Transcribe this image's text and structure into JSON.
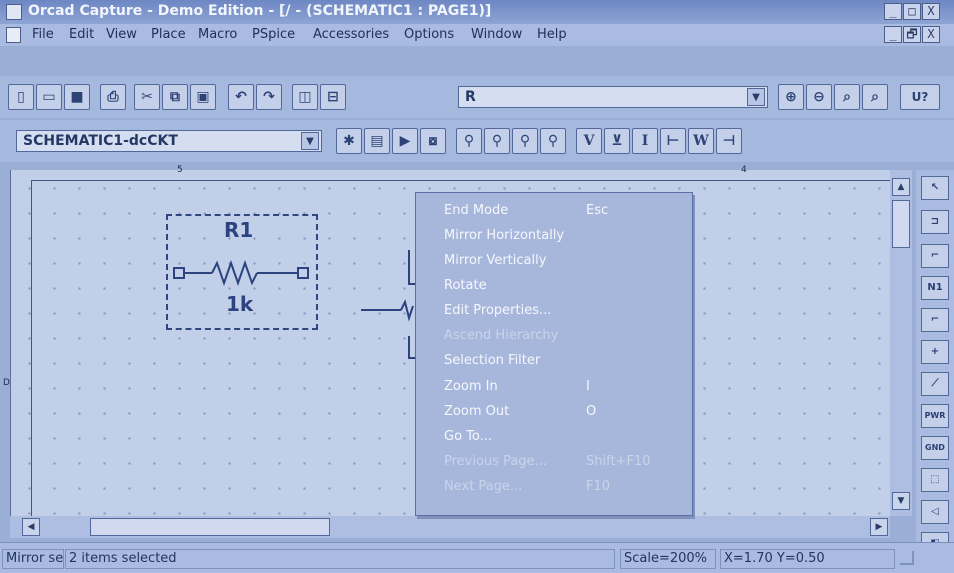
{
  "window": {
    "title": "Orcad Capture - Demo Edition - [/ - (SCHEMATIC1 : PAGE1)]",
    "controls": [
      "_",
      "□",
      "X"
    ],
    "doc_controls": [
      "_",
      "🗗",
      "X"
    ]
  },
  "menubar": {
    "items": [
      "File",
      "Edit",
      "View",
      "Place",
      "Macro",
      "PSpice",
      "Accessories",
      "Options",
      "Window",
      "Help"
    ]
  },
  "toolbar1": {
    "part_combo_value": "R",
    "u_label": "U?"
  },
  "toolbar2": {
    "schematic_combo_value": "SCHEMATIC1-dcCKT",
    "probe_labels": [
      "V",
      "I",
      "W"
    ]
  },
  "canvas": {
    "ruler_marks": [
      "5",
      "4"
    ],
    "left_mark": "D",
    "part": {
      "refdes": "R1",
      "value": "1k"
    }
  },
  "context_menu": {
    "items": [
      {
        "label": "End Mode",
        "shortcut": "Esc",
        "disabled": false
      },
      {
        "label": "Mirror Horizontally",
        "shortcut": "",
        "disabled": false
      },
      {
        "label": "Mirror Vertically",
        "shortcut": "",
        "disabled": false
      },
      {
        "label": "Rotate",
        "shortcut": "",
        "disabled": false
      },
      {
        "label": "Edit Properties...",
        "shortcut": "",
        "disabled": false
      },
      {
        "label": "Ascend Hierarchy",
        "shortcut": "",
        "disabled": true
      },
      {
        "label": "Selection Filter",
        "shortcut": "",
        "disabled": false
      },
      {
        "label": "Zoom In",
        "shortcut": "I",
        "disabled": false
      },
      {
        "label": "Zoom Out",
        "shortcut": "O",
        "disabled": false
      },
      {
        "label": "Go To...",
        "shortcut": "",
        "disabled": false
      },
      {
        "label": "Previous Page...",
        "shortcut": "Shift+F10",
        "disabled": true
      },
      {
        "label": "Next Page...",
        "shortcut": "F10",
        "disabled": true
      }
    ]
  },
  "palette": {
    "labels": [
      "N1",
      "PWR",
      "GND"
    ]
  },
  "statusbar": {
    "message": "Mirror se",
    "selection": "2 items selected",
    "scale": "Scale=200%",
    "coords": "X=1.70  Y=0.50"
  }
}
